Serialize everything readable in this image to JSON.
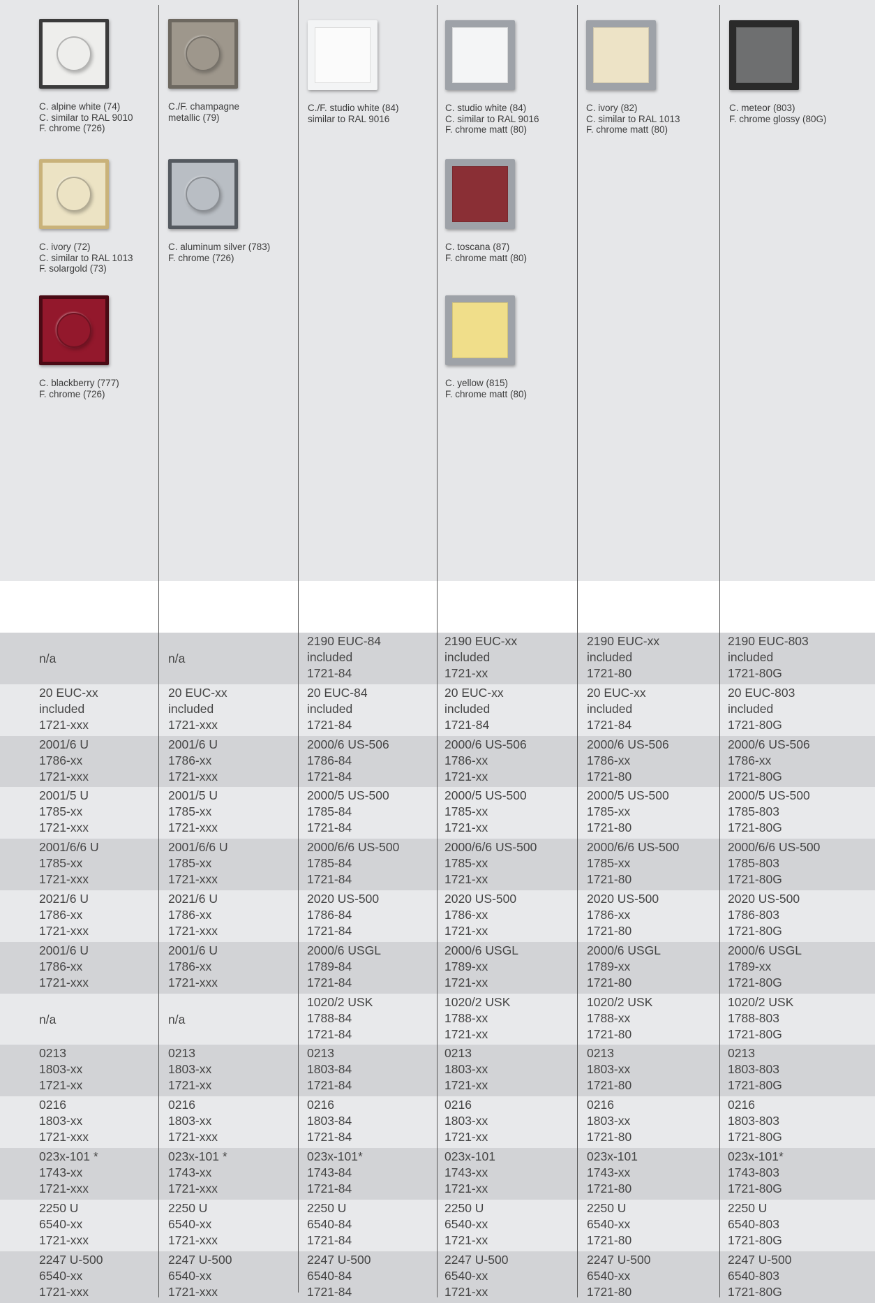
{
  "colors": {
    "background": "#e6e7e9",
    "row_light": "#e8e9eb",
    "row_dark": "#d2d3d6",
    "white_band": "#ffffff",
    "rule": "#555555"
  },
  "swatches": [
    {
      "caption": "C. alpine white (74)\nC. similar to RAL 9010\nF. chrome (726)",
      "frame": "#3b3b3b",
      "face": "#eeeeec",
      "knob": true,
      "icon": "round-dimmer-swatch-icon"
    },
    {
      "caption": "C. ivory (72)\nC. similar to RAL 1013\nF. solargold (73)",
      "frame": "#c9b27a",
      "face": "#ece3c4",
      "knob": true,
      "icon": "round-dimmer-swatch-icon"
    },
    {
      "caption": "C. blackberry (777)\nF. chrome (726)",
      "frame": "#4a0a14",
      "face": "#93182c",
      "knob": true,
      "icon": "round-dimmer-swatch-icon"
    },
    {
      "caption": "C./F. champagne\nmetallic (79)",
      "frame": "#6d6860",
      "face": "#9e978c",
      "knob": true,
      "icon": "round-dimmer-swatch-icon"
    },
    {
      "caption": "C. aluminum silver (783)\nF. chrome (726)",
      "frame": "#555a60",
      "face": "#b9bec4",
      "knob": true,
      "icon": "round-dimmer-swatch-icon"
    },
    {
      "caption": "C./F. studio white (84)\nsimilar to RAL 9016",
      "frame": "#f3f4f5",
      "face": "#fbfbfb",
      "knob": false,
      "icon": "square-plate-swatch-icon"
    },
    {
      "caption": "C. studio white (84)\nC. similar to RAL 9016\nF. chrome matt (80)",
      "frame": "#9ea2a8",
      "face": "#f4f5f6",
      "knob": false,
      "icon": "square-plate-swatch-icon"
    },
    {
      "caption": "C. toscana (87)\nF. chrome matt (80)",
      "frame": "#9ea2a8",
      "face": "#8a2f35",
      "knob": false,
      "icon": "square-plate-swatch-icon"
    },
    {
      "caption": "C. yellow (815)\nF. chrome matt (80)",
      "frame": "#9ea2a8",
      "face": "#f0de8a",
      "knob": false,
      "icon": "square-plate-swatch-icon"
    },
    {
      "caption": "C. ivory (82)\nC. similar to RAL 1013\nF. chrome matt (80)",
      "frame": "#9ea2a8",
      "face": "#ede3c6",
      "knob": false,
      "icon": "square-plate-swatch-icon"
    },
    {
      "caption": "C. meteor (803)\nF. chrome glossy (80G)",
      "frame": "#2a2a2a",
      "face": "#6e6f70",
      "knob": false,
      "icon": "square-plate-swatch-icon"
    }
  ],
  "rows": [
    [
      "n/a",
      "n/a",
      "2190 EUC-84\nincluded\n1721-84",
      "2190 EUC-xx\nincluded\n1721-xx",
      "2190 EUC-xx\nincluded\n1721-80",
      "2190 EUC-803\nincluded\n1721-80G"
    ],
    [
      "20 EUC-xx\nincluded\n1721-xxx",
      "20 EUC-xx\nincluded\n1721-xxx",
      "20 EUC-84\nincluded\n1721-84",
      "20 EUC-xx\nincluded\n1721-84",
      "20 EUC-xx\nincluded\n1721-84",
      "20 EUC-803\nincluded\n1721-80G"
    ],
    [
      "2001/6 U\n1786-xx\n1721-xxx",
      "2001/6 U\n1786-xx\n1721-xxx",
      "2000/6 US-506\n1786-84\n1721-84",
      "2000/6 US-506\n1786-xx\n1721-xx",
      "2000/6 US-506\n1786-xx\n1721-80",
      "2000/6 US-506\n1786-xx\n1721-80G"
    ],
    [
      "2001/5 U\n1785-xx\n1721-xxx",
      "2001/5 U\n1785-xx\n1721-xxx",
      "2000/5 US-500\n1785-84\n1721-84",
      "2000/5 US-500\n1785-xx\n1721-xx",
      "2000/5 US-500\n1785-xx\n1721-80",
      "2000/5 US-500\n1785-803\n1721-80G"
    ],
    [
      "2001/6/6 U\n1785-xx\n1721-xxx",
      "2001/6/6 U\n1785-xx\n1721-xxx",
      "2000/6/6 US-500\n1785-84\n1721-84",
      "2000/6/6 US-500\n1785-xx\n1721-xx",
      "2000/6/6 US-500\n1785-xx\n1721-80",
      "2000/6/6 US-500\n1785-803\n1721-80G"
    ],
    [
      "2021/6 U\n1786-xx\n1721-xxx",
      "2021/6 U\n1786-xx\n1721-xxx",
      "2020 US-500\n1786-84\n1721-84",
      "2020 US-500\n1786-xx\n1721-xx",
      "2020 US-500\n1786-xx\n1721-80",
      "2020 US-500\n1786-803\n1721-80G"
    ],
    [
      "2001/6 U\n1786-xx\n1721-xxx",
      "2001/6 U\n1786-xx\n1721-xxx",
      "2000/6 USGL\n1789-84\n1721-84",
      "2000/6 USGL\n1789-xx\n1721-xx",
      "2000/6 USGL\n1789-xx\n1721-80",
      "2000/6 USGL\n1789-xx\n1721-80G"
    ],
    [
      "n/a",
      "n/a",
      "1020/2 USK\n1788-84\n1721-84",
      "1020/2 USK\n1788-xx\n1721-xx",
      "1020/2 USK\n1788-xx\n1721-80",
      "1020/2 USK\n1788-803\n1721-80G"
    ],
    [
      "0213\n1803-xx\n1721-xx",
      "0213\n1803-xx\n1721-xx",
      "0213\n1803-84\n1721-84",
      "0213\n1803-xx\n1721-xx",
      "0213\n1803-xx\n1721-80",
      "0213\n1803-803\n1721-80G"
    ],
    [
      "0216\n1803-xx\n1721-xxx",
      "0216\n1803-xx\n1721-xxx",
      "0216\n1803-84\n1721-84",
      "0216\n1803-xx\n1721-xx",
      "0216\n1803-xx\n1721-80",
      "0216\n1803-803\n1721-80G"
    ],
    [
      "023x-101 *\n1743-xx\n1721-xxx",
      "023x-101 *\n1743-xx\n1721-xxx",
      "023x-101*\n1743-84\n1721-84",
      "023x-101\n1743-xx\n1721-xx",
      "023x-101\n1743-xx\n1721-80",
      "023x-101*\n1743-803\n1721-80G"
    ],
    [
      "2250 U\n6540-xx\n1721-xxx",
      "2250 U\n6540-xx\n1721-xxx",
      "2250 U\n6540-84\n1721-84",
      "2250 U\n6540-xx\n1721-xx",
      "2250 U\n6540-xx\n1721-80",
      "2250 U\n6540-803\n1721-80G"
    ],
    [
      "2247 U-500\n6540-xx\n1721-xxx",
      "2247 U-500\n6540-xx\n1721-xxx",
      "2247 U-500\n6540-84\n1721-84",
      "2247 U-500\n6540-xx\n1721-xx",
      "2247 U-500\n6540-xx\n1721-80",
      "2247 U-500\n6540-803\n1721-80G"
    ]
  ]
}
